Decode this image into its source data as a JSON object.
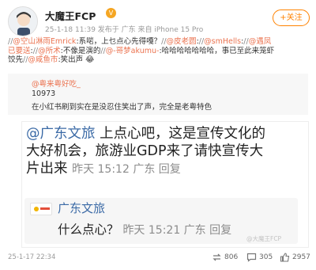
{
  "post": {
    "username": "大魔王FCP",
    "vip_badge": "V",
    "meta": "25-1-18 11:39 发布于 广东 来自 iPhone 15 Pro",
    "follow_label": "+关注"
  },
  "chain": {
    "line1": [
      {
        "type": "sep",
        "text": "//"
      },
      {
        "type": "at",
        "text": "@空山淋雨Emrick"
      },
      {
        "type": "text",
        "text": ":系啱，上乜点心先得嘎？"
      },
      {
        "type": "sep",
        "text": "//"
      },
      {
        "type": "at",
        "text": "@皮老圆"
      },
      {
        "type": "text",
        "text": ":"
      },
      {
        "type": "sep",
        "text": "//"
      },
      {
        "type": "at",
        "text": "@smHells"
      },
      {
        "type": "text",
        "text": ":"
      },
      {
        "type": "sep",
        "text": "//"
      },
      {
        "type": "at",
        "text": "@遇凤"
      }
    ],
    "line2": [
      {
        "type": "at",
        "text": "已要送"
      },
      {
        "type": "text",
        "text": ":"
      },
      {
        "type": "sep",
        "text": "//"
      },
      {
        "type": "at",
        "text": "@所术"
      },
      {
        "type": "text",
        "text": ":不像是演的"
      },
      {
        "type": "sep",
        "text": "//"
      },
      {
        "type": "at",
        "text": "@-哥梦akumu-"
      },
      {
        "type": "text",
        "text": ":哈哈哈哈哈哈哈，事已至此来笼虾"
      }
    ],
    "line3": [
      {
        "type": "text",
        "text": "饺先"
      },
      {
        "type": "sep",
        "text": "//"
      },
      {
        "type": "at",
        "text": "@咸鱼市"
      },
      {
        "type": "text",
        "text": ":笑出声"
      },
      {
        "type": "text",
        "text": " 😂"
      }
    ]
  },
  "quote": {
    "user": "@粤来粤好吃_",
    "count": "10973",
    "text": "在小红书刷到实在是没忍住笑出了声，完全是老粤特色"
  },
  "screenshot": {
    "line1_at": "@广东文旅",
    "line1_rest": " 上点心吧，这是宣传文化的",
    "line2": "大好机会，旅游业GDP来了请快宣传大",
    "line3": "片出来 ",
    "line3_meta": "昨天 15:12 广东 回复",
    "reply_name": "广东文旅",
    "reply_text": "什么点心？ ",
    "reply_meta": "昨天 15:21 广东 回复",
    "watermark": "@大魔王FCP"
  },
  "footer": {
    "date": "25-1-17 22:34",
    "repost_count": "806",
    "comment_count": "305",
    "like_count": "2957"
  },
  "colors": {
    "accent": "#ff8200",
    "mention": "#eb7350",
    "link_blue": "#3b6aa6"
  }
}
